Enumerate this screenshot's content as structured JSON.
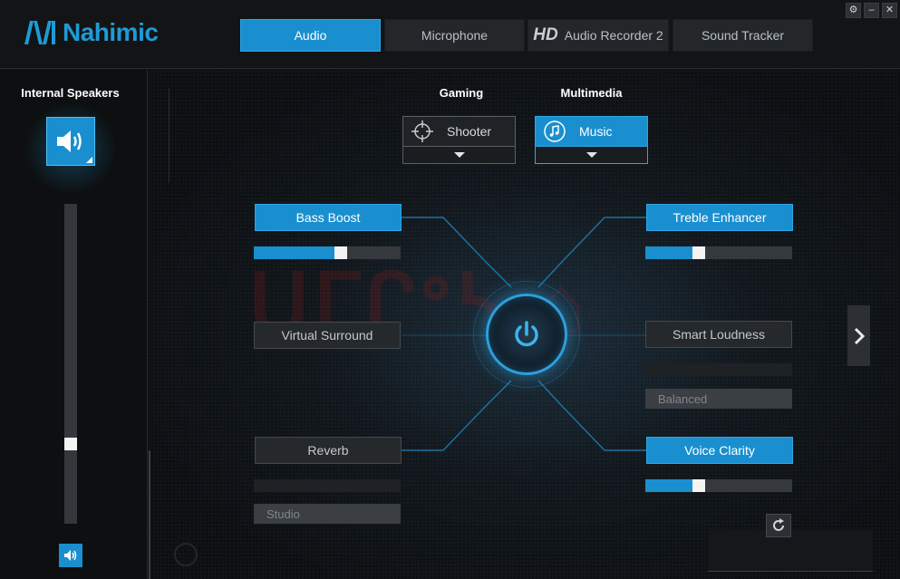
{
  "app": {
    "name": "Nahimic",
    "brand_color": "#1e9bd7"
  },
  "tabs": [
    {
      "label": "Audio",
      "active": true
    },
    {
      "label": "Microphone",
      "active": false
    },
    {
      "label": "Audio Recorder 2",
      "prefix": "HD",
      "active": false
    },
    {
      "label": "Sound Tracker",
      "active": false
    }
  ],
  "window_controls": [
    {
      "name": "settings",
      "icon": "gear-icon",
      "glyph": "⚙"
    },
    {
      "name": "minimize",
      "icon": "minimize-icon",
      "glyph": "–"
    },
    {
      "name": "close",
      "icon": "close-icon",
      "glyph": "✕"
    }
  ],
  "sidebar": {
    "device_title": "Internal Speakers",
    "device_icon": "speaker-icon",
    "volume_level": 0.24,
    "mute_icon": "speaker-small-icon"
  },
  "presets": {
    "gaming": {
      "label": "Gaming",
      "value": "Shooter",
      "icon": "crosshair-icon"
    },
    "multimedia": {
      "label": "Multimedia",
      "value": "Music",
      "icon": "music-note-icon"
    }
  },
  "features": {
    "bass_boost": {
      "label": "Bass Boost",
      "enabled": true,
      "level": 0.6
    },
    "treble_enhancer": {
      "label": "Treble Enhancer",
      "enabled": true,
      "level": 0.35
    },
    "virtual_surround": {
      "label": "Virtual Surround",
      "enabled": false
    },
    "smart_loudness": {
      "label": "Smart Loudness",
      "enabled": false,
      "option": "Balanced"
    },
    "reverb": {
      "label": "Reverb",
      "enabled": false,
      "option": "Studio"
    },
    "voice_clarity": {
      "label": "Voice Clarity",
      "enabled": true,
      "level": 0.35
    }
  },
  "power": {
    "on": true,
    "icon": "power-icon"
  },
  "controls": {
    "next_icon": "chevron-right-icon",
    "reset_icon": "reset-icon"
  },
  "colors": {
    "accent": "#1a8fcf",
    "panel": "#26292c",
    "background": "#101214"
  }
}
